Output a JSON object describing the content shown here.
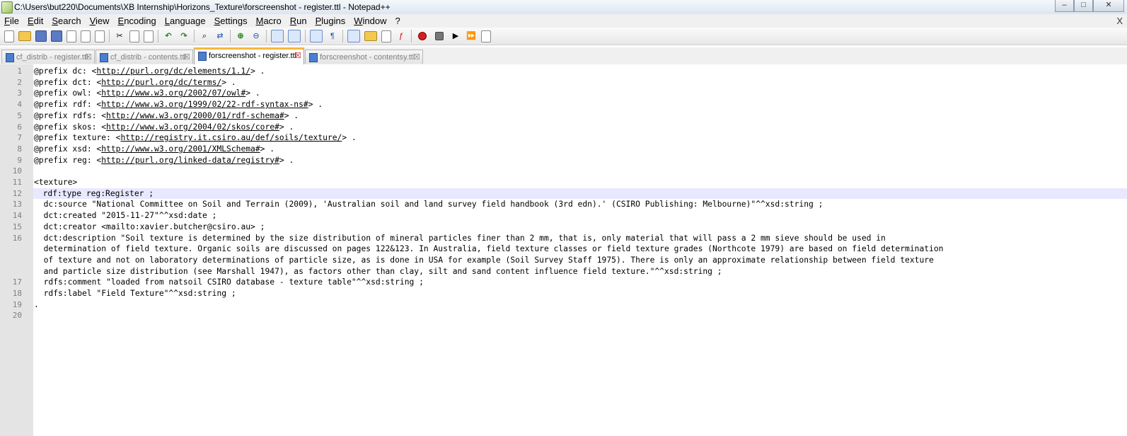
{
  "window": {
    "title": "C:\\Users\\but220\\Documents\\XB Internship\\Horizons_Texture\\forscreenshot - register.ttl - Notepad++",
    "minimize_glyph": "–",
    "maximize_glyph": "□",
    "close_glyph": "✕",
    "doc_close_glyph": "X"
  },
  "menu": [
    "File",
    "Edit",
    "Search",
    "View",
    "Encoding",
    "Language",
    "Settings",
    "Macro",
    "Run",
    "Plugins",
    "Window",
    "?"
  ],
  "tabs": [
    {
      "label": "cf_distrib - register.ttl",
      "active": false
    },
    {
      "label": "cf_distrib - contents.ttl",
      "active": false
    },
    {
      "label": "forscreenshot - register.ttl",
      "active": true
    },
    {
      "label": "forscreenshot - contentsy.ttl",
      "active": false
    }
  ],
  "tab_close_glyph": "☒",
  "editor": {
    "current_line": 12,
    "lines": [
      {
        "n": "1",
        "text": "@prefix dc: <http://purl.org/dc/elements/1.1/> ."
      },
      {
        "n": "2",
        "text": "@prefix dct: <http://purl.org/dc/terms/> ."
      },
      {
        "n": "3",
        "text": "@prefix owl: <http://www.w3.org/2002/07/owl#> ."
      },
      {
        "n": "4",
        "text": "@prefix rdf: <http://www.w3.org/1999/02/22-rdf-syntax-ns#> ."
      },
      {
        "n": "5",
        "text": "@prefix rdfs: <http://www.w3.org/2000/01/rdf-schema#> ."
      },
      {
        "n": "6",
        "text": "@prefix skos: <http://www.w3.org/2004/02/skos/core#> ."
      },
      {
        "n": "7",
        "text": "@prefix texture: <http://registry.it.csiro.au/def/soils/texture/> ."
      },
      {
        "n": "8",
        "text": "@prefix xsd: <http://www.w3.org/2001/XMLSchema#> ."
      },
      {
        "n": "9",
        "text": "@prefix reg: <http://purl.org/linked-data/registry#> ."
      },
      {
        "n": "10",
        "text": ""
      },
      {
        "n": "11",
        "text": "<texture>"
      },
      {
        "n": "12",
        "text": "  rdf:type reg:Register ;"
      },
      {
        "n": "13",
        "text": "  dc:source \"National Committee on Soil and Terrain (2009), 'Australian soil and land survey field handbook (3rd edn).' (CSIRO Publishing: Melbourne)\"^^xsd:string ;"
      },
      {
        "n": "14",
        "text": "  dct:created \"2015-11-27\"^^xsd:date ;"
      },
      {
        "n": "15",
        "text": "  dct:creator <mailto:xavier.butcher@csiro.au> ;"
      },
      {
        "n": "16",
        "text": "  dct:description \"Soil texture is determined by the size distribution of mineral particles finer than 2 mm, that is, only material that will pass a 2 mm sieve should be used in"
      },
      {
        "n": "",
        "text": "  determination of field texture. Organic soils are discussed on pages 122&123. In Australia, field texture classes or field texture grades (Northcote 1979) are based on field determination"
      },
      {
        "n": "",
        "text": "  of texture and not on laboratory determinations of particle size, as is done in USA for example (Soil Survey Staff 1975). There is only an approximate relationship between field texture"
      },
      {
        "n": "",
        "text": "  and particle size distribution (see Marshall 1947), as factors other than clay, silt and sand content influence field texture.\"^^xsd:string ;"
      },
      {
        "n": "17",
        "text": "  rdfs:comment \"loaded from natsoil CSIRO database - texture table\"^^xsd:string ;"
      },
      {
        "n": "18",
        "text": "  rdfs:label \"Field Texture\"^^xsd:string ;"
      },
      {
        "n": "19",
        "text": "."
      },
      {
        "n": "20",
        "text": ""
      }
    ]
  }
}
